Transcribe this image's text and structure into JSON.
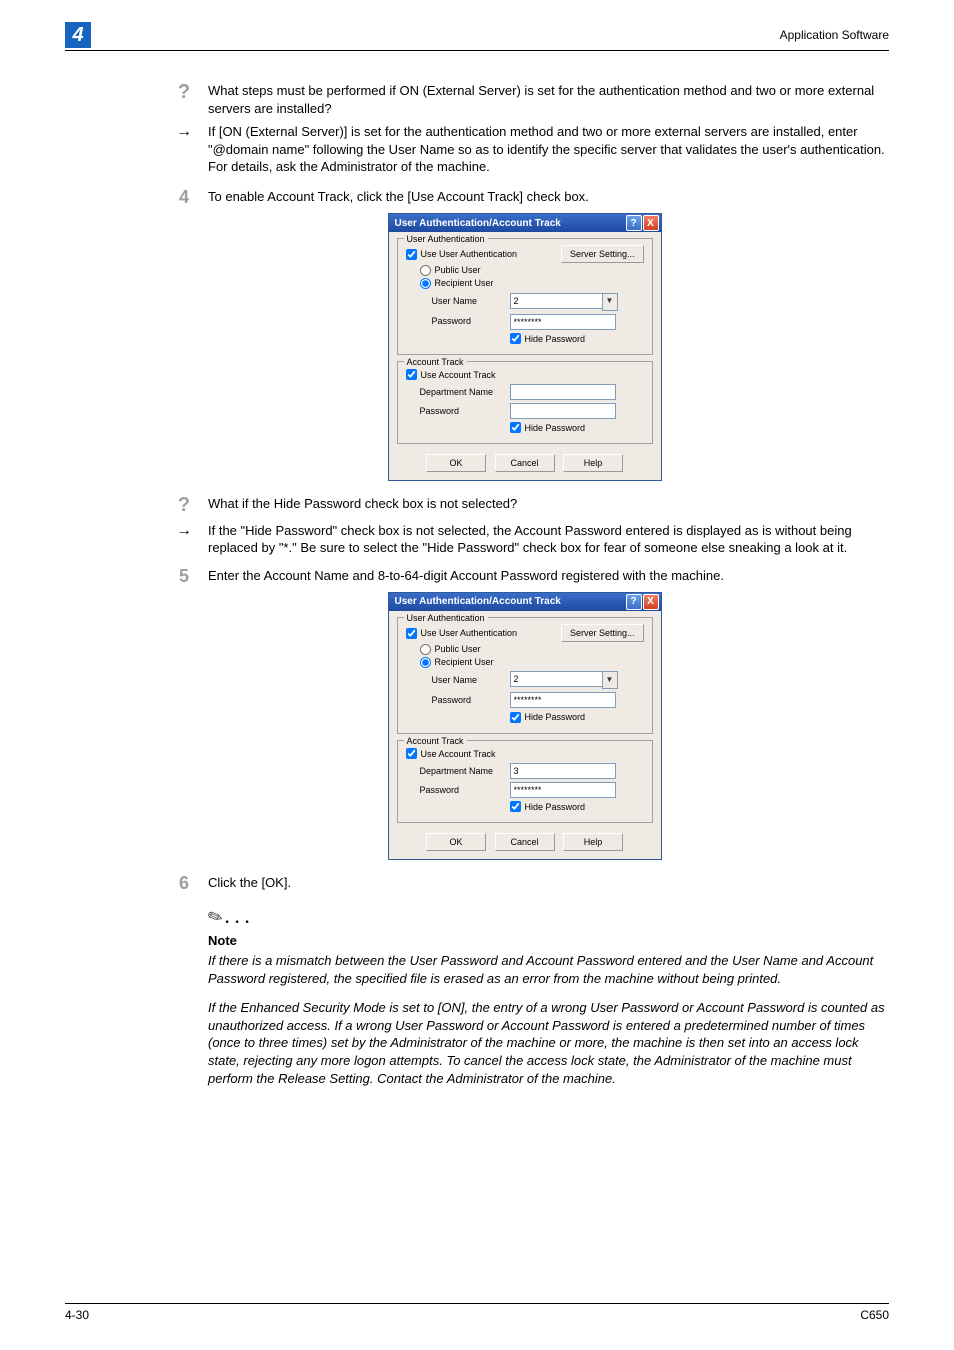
{
  "header": {
    "chapter": "4",
    "title": "Application Software"
  },
  "q1": {
    "q": "What steps must be performed if ON (External Server) is set for the authentication method and two or more external servers are installed?",
    "a": "If [ON (External Server)] is set for the authentication method and two or more external servers are installed, enter \"@domain name\" following the User Name so as to identify the specific server that validates the user's authentication. For details, ask the Administrator of the machine."
  },
  "step4": {
    "num": "4",
    "text": "To enable Account Track, click the [Use Account Track] check box."
  },
  "q2": {
    "q": "What if the Hide Password check box is not selected?",
    "a": "If the \"Hide Password\" check box is not selected, the Account Password entered is displayed as is without being replaced by \"*.\" Be sure to select the \"Hide Password\" check box for fear of someone else sneaking a look at it."
  },
  "step5": {
    "num": "5",
    "text": "Enter the Account Name and 8-to-64-digit Account Password registered with the machine."
  },
  "step6": {
    "num": "6",
    "text": "Click the [OK]."
  },
  "dialog": {
    "title": "User Authentication/Account Track",
    "grp1_title": "User Authentication",
    "use_user_auth": "Use User Authentication",
    "server_setting": "Server Setting...",
    "public_user": "Public User",
    "recipient_user": "Recipient User",
    "user_name_lbl": "User Name",
    "user_name_val": "2",
    "password_lbl": "Password",
    "password_val_masked": "********",
    "hide_password": "Hide Password",
    "grp2_title": "Account Track",
    "use_account_track": "Use Account Track",
    "dept_name_lbl": "Department Name",
    "dept_name_val1": "",
    "dept_name_val2": "3",
    "acct_pw_val1": "",
    "acct_pw_val2": "********",
    "ok": "OK",
    "cancel": "Cancel",
    "help": "Help"
  },
  "note": {
    "label": "Note",
    "p1": "If there is a mismatch between the User Password and Account Password entered and the User Name and Account Password registered, the specified file is erased as an error from the machine without being printed.",
    "p2": "If the Enhanced Security Mode is set to [ON], the entry of a wrong User Password or Account Password is counted as unauthorized access. If a wrong User Password or Account Password is entered a predetermined number of times (once to three times) set by the Administrator of the machine or more, the machine is then set into an access lock state, rejecting any more logon attempts. To cancel the access lock state, the Administrator of the machine must perform the Release Setting. Contact the Administrator of the machine."
  },
  "footer": {
    "page": "4-30",
    "model": "C650"
  }
}
